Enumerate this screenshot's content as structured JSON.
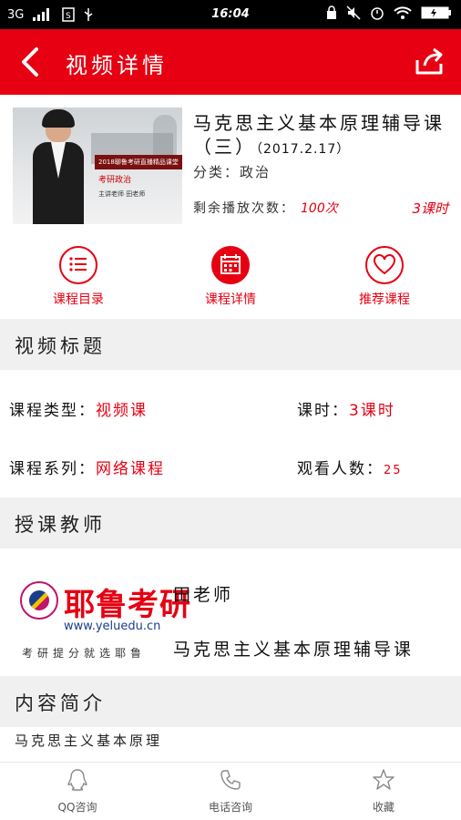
{
  "status_bar": {
    "network": "3G",
    "time": "16:04"
  },
  "header": {
    "title": "视频详情"
  },
  "course": {
    "title": "马克思主义基本原理辅导课（三）",
    "date": "（2017.2.17）",
    "category_label": "分类：",
    "category": "政治",
    "remaining_label": "剩余播放次数：",
    "remaining": "100次",
    "hours": "3课时",
    "thumbnail": {
      "banner": "2018聊鲁考研直播精品课堂",
      "subject": "考研政治",
      "teacher": "主讲老师 田老师"
    }
  },
  "tabs": [
    {
      "label": "课程目录",
      "icon": "list-icon"
    },
    {
      "label": "课程详情",
      "icon": "calendar-icon"
    },
    {
      "label": "推荐课程",
      "icon": "heart-icon"
    }
  ],
  "sections": {
    "video_title": "视频标题",
    "teacher": "授课教师",
    "intro": "内容简介"
  },
  "details": {
    "type_label": "课程类型：",
    "type": "视频课",
    "hours_label": "课时：",
    "hours": "3课时",
    "series_label": "课程系列：",
    "series": "网络课程",
    "viewers_label": "观看人数：",
    "viewers": "25"
  },
  "teacher": {
    "logo_name": "耶鲁考研",
    "logo_url": "www.yeluedu.cn",
    "logo_slogan": "考研提分就选耶鲁",
    "name": "田老师",
    "course": "马克思主义基本原理辅导课"
  },
  "intro_text": "马克思主义基本原理",
  "bottom_nav": [
    {
      "label": "QQ咨询",
      "icon": "qq-icon"
    },
    {
      "label": "电话咨询",
      "icon": "phone-icon"
    },
    {
      "label": "收藏",
      "icon": "star-icon"
    }
  ],
  "colors": {
    "brand": "#e60012",
    "section_bg": "#f0f0f0"
  }
}
